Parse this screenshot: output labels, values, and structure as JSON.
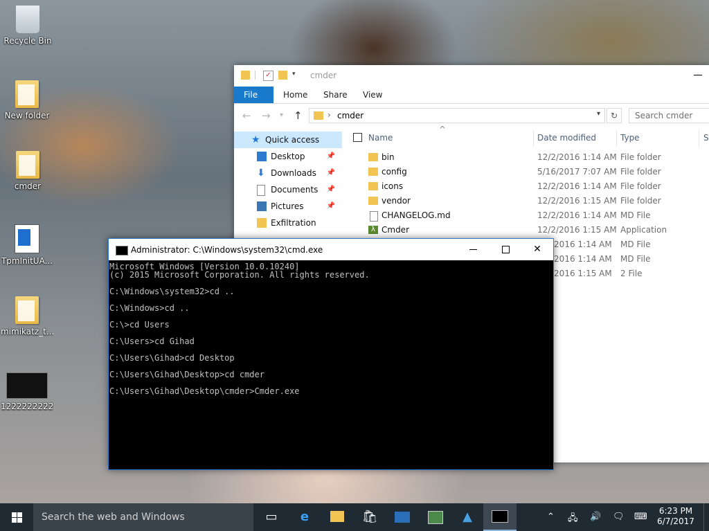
{
  "desktop": {
    "icons": [
      {
        "label": "Recycle Bin"
      },
      {
        "label": "New folder"
      },
      {
        "label": "cmder"
      },
      {
        "label": "TpmInitUA..."
      },
      {
        "label": "mimikatz_t..."
      },
      {
        "label": "1222222222..."
      }
    ]
  },
  "explorer": {
    "title": "cmder",
    "tabs": [
      "File",
      "Home",
      "Share",
      "View"
    ],
    "address": "cmder",
    "search_placeholder": "Search cmder",
    "nav": [
      {
        "label": "Quick access",
        "pinned": false
      },
      {
        "label": "Desktop",
        "pinned": true
      },
      {
        "label": "Downloads",
        "pinned": true
      },
      {
        "label": "Documents",
        "pinned": true
      },
      {
        "label": "Pictures",
        "pinned": true
      },
      {
        "label": "Exfiltration",
        "pinned": false
      }
    ],
    "columns": {
      "name": "Name",
      "date": "Date modified",
      "type": "Type",
      "size": "Si"
    },
    "files": [
      {
        "name": "bin",
        "date": "12/2/2016 1:14 AM",
        "type": "File folder",
        "icon": "folder-icon"
      },
      {
        "name": "config",
        "date": "5/16/2017 7:07 AM",
        "type": "File folder",
        "icon": "folder-icon"
      },
      {
        "name": "icons",
        "date": "12/2/2016 1:14 AM",
        "type": "File folder",
        "icon": "folder-icon"
      },
      {
        "name": "vendor",
        "date": "12/2/2016 1:15 AM",
        "type": "File folder",
        "icon": "folder-icon"
      },
      {
        "name": "CHANGELOG.md",
        "date": "12/2/2016 1:14 AM",
        "type": "MD File",
        "icon": "document-icon"
      },
      {
        "name": "Cmder",
        "date": "12/2/2016 1:15 AM",
        "type": "Application",
        "icon": "lambda-app-icon"
      },
      {
        "name": "",
        "date": "/2016 1:14 AM",
        "type": "MD File",
        "icon": ""
      },
      {
        "name": "",
        "date": "/2016 1:14 AM",
        "type": "MD File",
        "icon": ""
      },
      {
        "name": "",
        "date": "/2016 1:15 AM",
        "type": "2 File",
        "icon": ""
      }
    ]
  },
  "cmd": {
    "title": "Administrator: C:\\Windows\\system32\\cmd.exe",
    "lines": [
      "Microsoft Windows [Version 10.0.10240]",
      "(c) 2015 Microsoft Corporation. All rights reserved.",
      "",
      "C:\\Windows\\system32>cd ..",
      "",
      "C:\\Windows>cd ..",
      "",
      "C:\\>cd Users",
      "",
      "C:\\Users>cd Gihad",
      "",
      "C:\\Users\\Gihad>cd Desktop",
      "",
      "C:\\Users\\Gihad\\Desktop>cd cmder",
      "",
      "C:\\Users\\Gihad\\Desktop\\cmder>Cmder.exe"
    ]
  },
  "taskbar": {
    "search_placeholder": "Search the web and Windows",
    "apps": [
      "task-view-icon",
      "edge-icon",
      "file-explorer-icon",
      "store-icon",
      "powershell-icon",
      "terminal-icon",
      "shark-icon",
      "cmd-icon"
    ],
    "time": "6:23 PM",
    "date": "6/7/2017"
  }
}
